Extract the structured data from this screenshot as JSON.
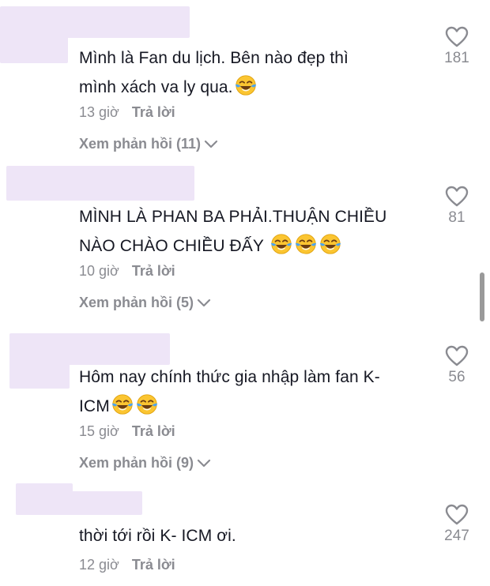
{
  "comments": [
    {
      "text": "Mình là Fan du lịch. Bên nào đẹp thì\nmình xách va ly qua.",
      "emoji_count": 1,
      "time": "13 giờ",
      "reply_label": "Trả lời",
      "view_replies": "Xem phản hồi (11)",
      "likes": "181"
    },
    {
      "text": "MÌNH LÀ PHAN BA PHẢI.THUẬN CHIỀU\nNÀO CHÀO CHIỀU ĐẤY ",
      "emoji_count": 3,
      "time": "10 giờ",
      "reply_label": "Trả lời",
      "view_replies": "Xem phản hồi (5)",
      "likes": "81"
    },
    {
      "text": "Hôm nay chính thức gia nhập làm fan K-\nICM",
      "emoji_count": 2,
      "time": "15 giờ",
      "reply_label": "Trả lời",
      "view_replies": "Xem phản hồi (9)",
      "likes": "56"
    },
    {
      "text": "thời tới rồi K- ICM ơi.",
      "emoji_count": 0,
      "time": "12 giờ",
      "reply_label": "Trả lời",
      "view_replies": "",
      "likes": "247"
    }
  ],
  "icons": {
    "like": "heart-outline-icon",
    "expand": "chevron-down-icon",
    "emoji": "face-with-tears-of-joy-emoji"
  },
  "colors": {
    "text": "#161823",
    "secondary": "#8a8b91",
    "redacted_username": "#eee5f7"
  }
}
